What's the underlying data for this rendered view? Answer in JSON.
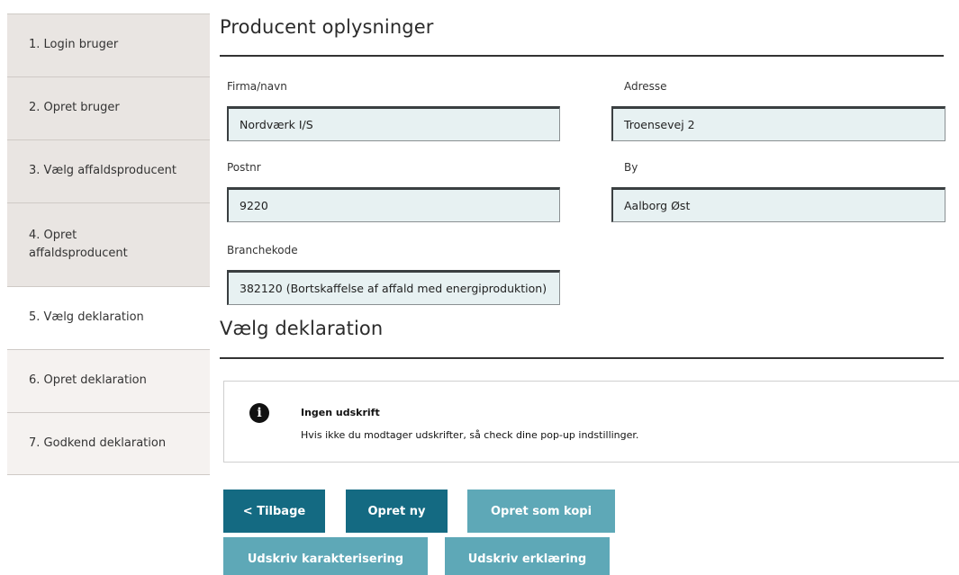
{
  "sidebar": {
    "steps": [
      {
        "label": "1. Login bruger"
      },
      {
        "label": "2. Opret bruger"
      },
      {
        "label": "3. Vælg affaldsproducent"
      },
      {
        "label": "4. Opret affaldsproducent"
      },
      {
        "label": "5. Vælg deklaration"
      },
      {
        "label": "6. Opret deklaration"
      },
      {
        "label": "7. Godkend deklaration"
      }
    ]
  },
  "producer": {
    "title": "Producent oplysninger",
    "firma_label": "Firma/navn",
    "firma_value": "Nordværk I/S",
    "adresse_label": "Adresse",
    "adresse_value": "Troensevej 2",
    "postnr_label": "Postnr",
    "postnr_value": "9220",
    "by_label": "By",
    "by_value": "Aalborg Øst",
    "branchekode_label": "Branchekode",
    "branchekode_value": "382120 (Bortskaffelse af affald med energiproduktion)"
  },
  "declaration": {
    "title": "Vælg deklaration"
  },
  "info": {
    "icon": "info-icon",
    "title": "Ingen udskrift",
    "text": "Hvis ikke du modtager udskrifter, så check dine pop-up indstillinger."
  },
  "buttons": {
    "back": "< Tilbage",
    "new": "Opret ny",
    "copy": "Opret som kopi",
    "print_char": "Udskriv karakterisering",
    "print_decl": "Udskriv erklæring"
  },
  "colors": {
    "primary_button": "#146a82",
    "disabled_button": "#5ea8b7",
    "field_background": "#e7f1f2",
    "sidebar_done": "#e9e5e2",
    "sidebar_todo": "#f5f2f0"
  }
}
